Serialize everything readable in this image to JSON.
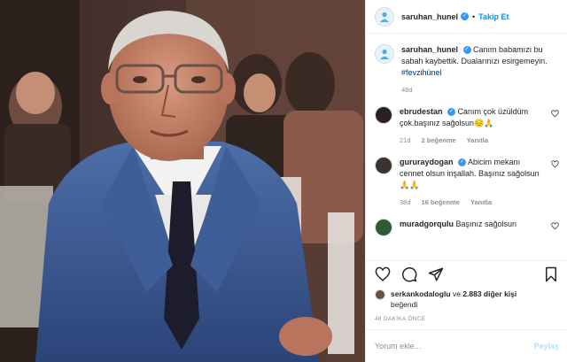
{
  "post": {
    "username": "saruhan_hunel",
    "follow_label": "Takip Et",
    "caption_text": "Canım babamızı bu sabah kaybettik. Dualarınızı esirgemeyin.",
    "hashtag": "#fevzihünel",
    "caption_time": "48d"
  },
  "comments": [
    {
      "username": "ebrudestan",
      "text": "Canım çok üzüldüm çok.başınız sağolsun😔🙏",
      "time": "21d",
      "likes": "2 beğenme",
      "reply": "Yanıtla"
    },
    {
      "username": "gururaydogan",
      "text": "Abicim mekanı cennet olsun inşallah. Başınız sağolsun 🙏🙏",
      "time": "38d",
      "likes": "16 beğenme",
      "reply": "Yanıtla"
    },
    {
      "username": "muradgorqulu",
      "text": "Başınız sağolsun"
    }
  ],
  "likes": {
    "liker": "serkankodaloglu",
    "connector": "ve",
    "others": "2.883 diğer kişi",
    "suffix": "beğendi"
  },
  "post_time": "48 DAKİKA ÖNCE",
  "comment_box": {
    "placeholder": "Yorum ekle...",
    "share_label": "Paylaş"
  },
  "colors": {
    "accent": "#0095f6",
    "verified": "#3897f0",
    "muted": "#8e8e8e",
    "share_disabled": "#b2dffc"
  }
}
